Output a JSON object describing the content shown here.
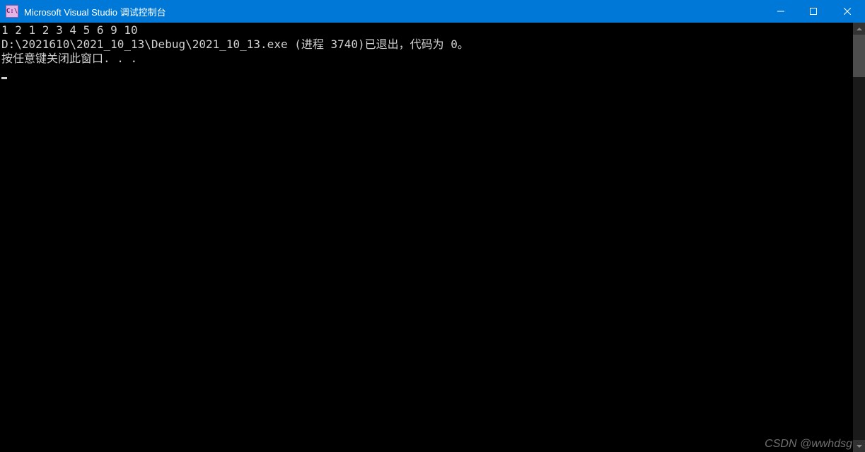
{
  "titlebar": {
    "app_icon_text": "C:\\",
    "title": "Microsoft Visual Studio 调试控制台"
  },
  "console": {
    "line1": "1 2 1 2 3 4 5 6 9 10",
    "line2": "D:\\2021610\\2021_10_13\\Debug\\2021_10_13.exe (进程 3740)已退出，代码为 0。",
    "line3": "按任意键关闭此窗口. . ."
  },
  "watermark": "CSDN @wwhdsg"
}
